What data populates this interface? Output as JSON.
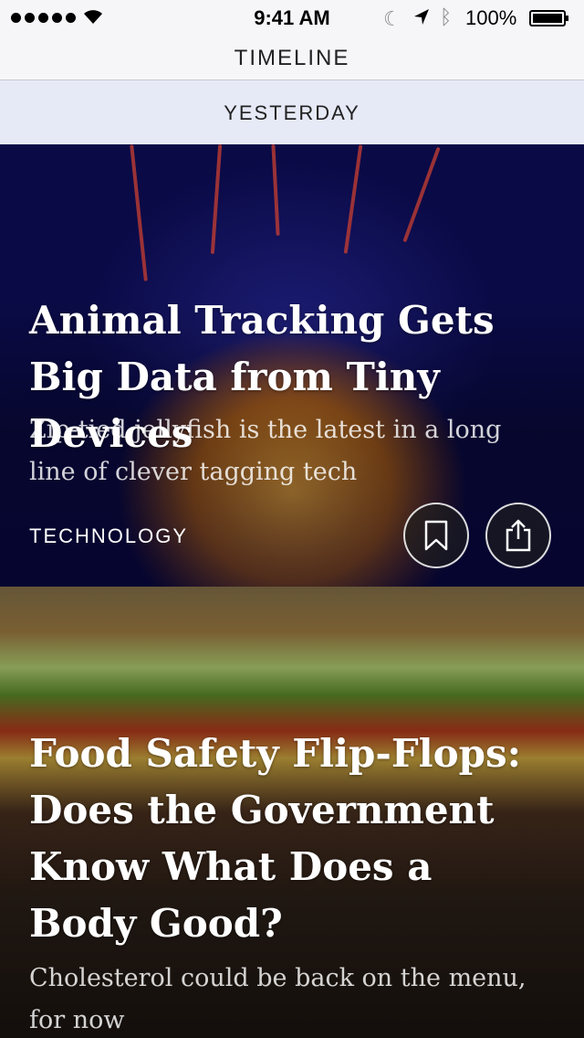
{
  "status_bar": {
    "time": "9:41 AM",
    "battery": "100%",
    "icons": [
      "signal-dots-icon",
      "wifi-icon",
      "moon-icon",
      "location-arrow-icon",
      "bluetooth-icon",
      "battery-icon"
    ]
  },
  "nav": {
    "title": "TIMELINE"
  },
  "section": {
    "label": "YESTERDAY"
  },
  "articles": [
    {
      "title": "Animal Tracking Gets Big Data from Tiny Devices",
      "summary": "Zip-tied jellyfish is the latest in a long line of clever tagging tech",
      "category": "TECHNOLOGY",
      "actions": [
        "bookmark-icon",
        "share-icon"
      ]
    },
    {
      "title": "Food Safety Flip-Flops: Does the Government Know What Does a Body Good?",
      "summary": "Cholesterol could be back on the menu, for now"
    }
  ]
}
